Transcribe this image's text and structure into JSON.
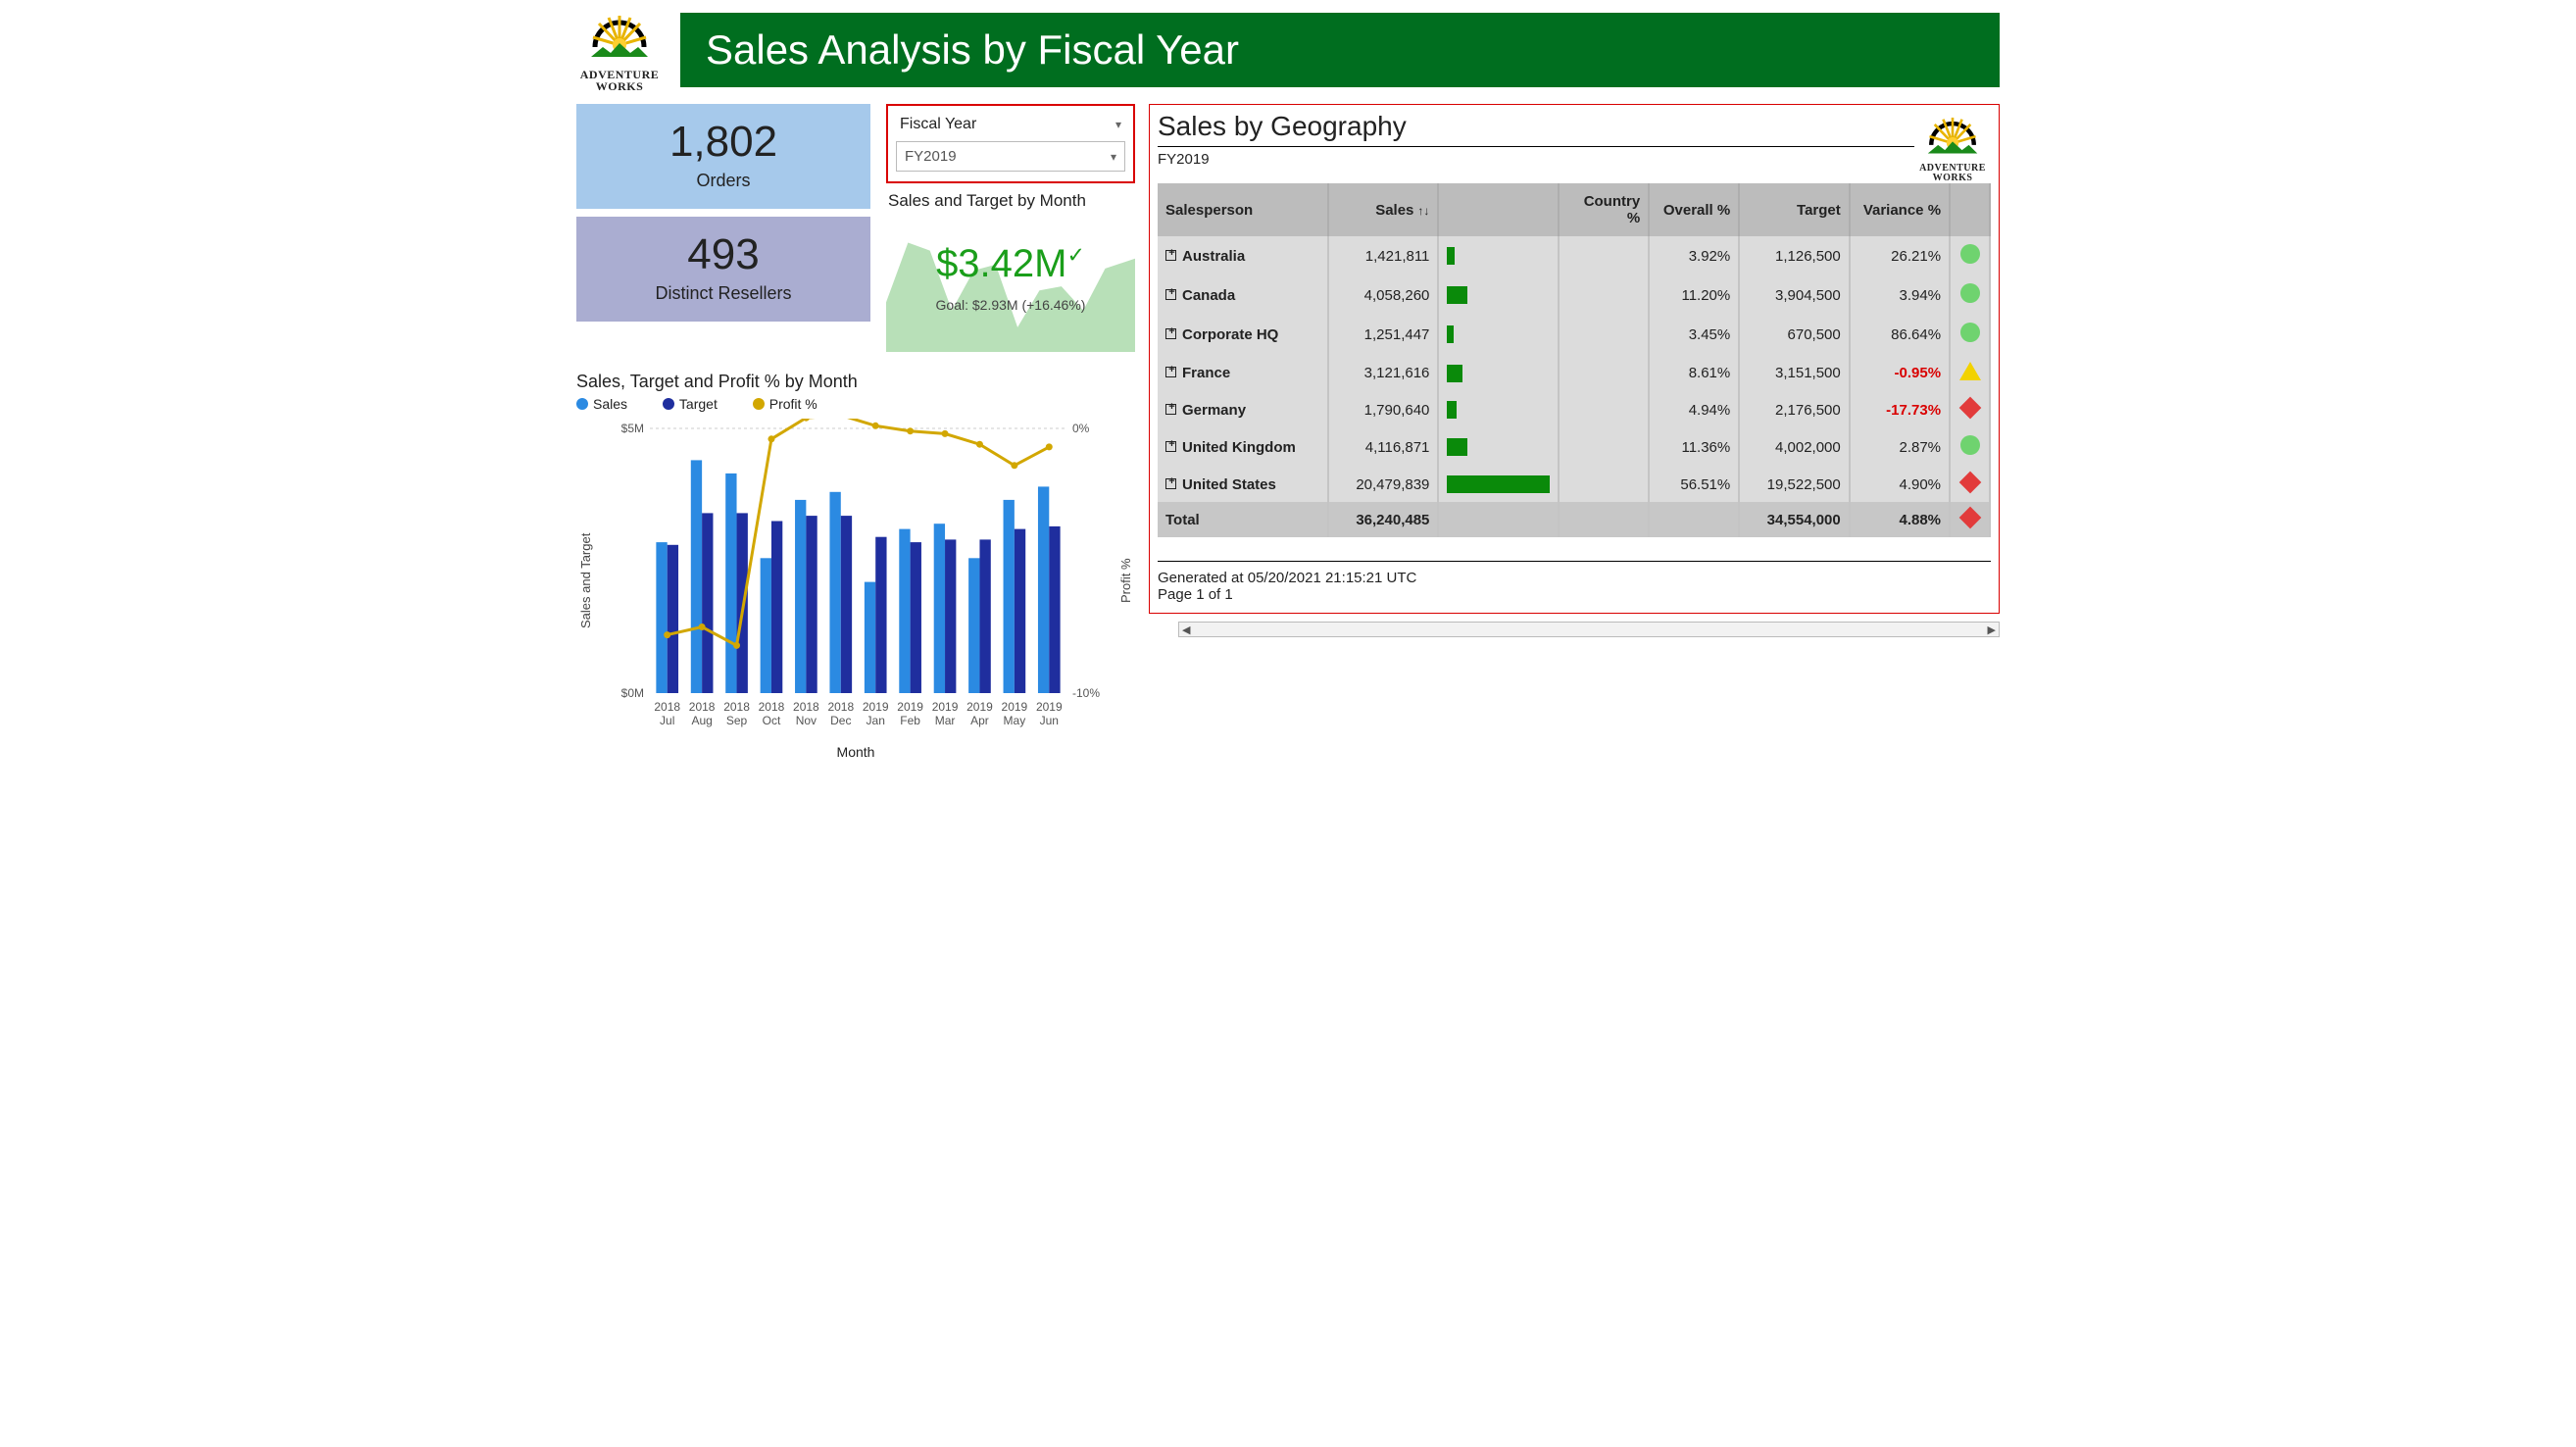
{
  "header": {
    "title": "Sales Analysis by Fiscal Year",
    "logo_top": "ADVENTURE",
    "logo_bot": "WORKS"
  },
  "cards": {
    "orders_value": "1,802",
    "orders_label": "Orders",
    "resellers_value": "493",
    "resellers_label": "Distinct Resellers"
  },
  "slicer": {
    "label": "Fiscal Year",
    "value": "FY2019"
  },
  "mini": {
    "title": "Sales and Target by Month",
    "value": "$3.42M",
    "goal": "Goal: $2.93M (+16.46%)"
  },
  "combo": {
    "title": "Sales, Target and Profit % by Month",
    "legend": {
      "sales": "Sales",
      "target": "Target",
      "profit": "Profit %"
    },
    "y_left_label": "Sales and Target",
    "y_right_label": "Profit %",
    "x_label": "Month"
  },
  "geo": {
    "title": "Sales by Geography",
    "fy": "FY2019",
    "cols": {
      "sp": "Salesperson",
      "sales": "Sales",
      "country": "Country %",
      "overall": "Overall %",
      "target": "Target",
      "var": "Variance %"
    },
    "footer1": "Generated at 05/20/2021 21:15:21 UTC",
    "footer2": "Page 1 of 1",
    "rows": [
      {
        "name": "Australia",
        "sales": "1,421,811",
        "overall": "3.92%",
        "target": "1,126,500",
        "var": "26.21%",
        "ind": "g"
      },
      {
        "name": "Canada",
        "sales": "4,058,260",
        "overall": "11.20%",
        "target": "3,904,500",
        "var": "3.94%",
        "ind": "g"
      },
      {
        "name": "Corporate HQ",
        "sales": "1,251,447",
        "overall": "3.45%",
        "target": "670,500",
        "var": "86.64%",
        "ind": "g"
      },
      {
        "name": "France",
        "sales": "3,121,616",
        "overall": "8.61%",
        "target": "3,151,500",
        "var": "-0.95%",
        "ind": "y"
      },
      {
        "name": "Germany",
        "sales": "1,790,640",
        "overall": "4.94%",
        "target": "2,176,500",
        "var": "-17.73%",
        "ind": "r"
      },
      {
        "name": "United Kingdom",
        "sales": "4,116,871",
        "overall": "11.36%",
        "target": "4,002,000",
        "var": "2.87%",
        "ind": "g"
      },
      {
        "name": "United States",
        "sales": "20,479,839",
        "overall": "56.51%",
        "target": "19,522,500",
        "var": "4.90%",
        "ind": "r"
      }
    ],
    "total": {
      "name": "Total",
      "sales": "36,240,485",
      "target": "34,554,000",
      "var": "4.88%",
      "ind": "r"
    }
  },
  "chart_data": [
    {
      "type": "bar+line",
      "title": "Sales, Target and Profit % by Month",
      "categories": [
        "2018 Jul",
        "2018 Aug",
        "2018 Sep",
        "2018 Oct",
        "2018 Nov",
        "2018 Dec",
        "2019 Jan",
        "2019 Feb",
        "2019 Mar",
        "2019 Apr",
        "2019 May",
        "2019 Jun"
      ],
      "series": [
        {
          "name": "Sales",
          "axis": "left",
          "type": "bar",
          "values": [
            2.85,
            4.4,
            4.15,
            2.55,
            3.65,
            3.8,
            2.1,
            3.1,
            3.2,
            2.55,
            3.65,
            3.9
          ]
        },
        {
          "name": "Target",
          "axis": "left",
          "type": "bar",
          "values": [
            2.8,
            3.4,
            3.4,
            3.25,
            3.35,
            3.35,
            2.95,
            2.85,
            2.9,
            2.9,
            3.1,
            3.15
          ]
        },
        {
          "name": "Profit %",
          "axis": "right",
          "type": "line",
          "values": [
            -7.8,
            -7.5,
            -8.2,
            -0.4,
            0.4,
            0.5,
            0.1,
            -0.1,
            -0.2,
            -0.6,
            -1.4,
            -0.7
          ]
        }
      ],
      "y_left": {
        "label": "Sales and Target",
        "unit": "$M",
        "ticks": [
          0,
          5
        ]
      },
      "y_right": {
        "label": "Profit %",
        "unit": "%",
        "ticks": [
          -10,
          0
        ]
      },
      "xlabel": "Month"
    },
    {
      "type": "area",
      "title": "Sales and Target by Month (sparkline)",
      "kpi_value": "$3.42M",
      "goal": "$2.93M",
      "goal_delta_pct": 16.46,
      "values": [
        2.85,
        4.4,
        4.15,
        2.55,
        3.65,
        3.8,
        2.1,
        3.1,
        3.2,
        2.55,
        3.65,
        3.9
      ]
    },
    {
      "type": "table",
      "title": "Sales by Geography",
      "filter": "FY2019",
      "columns": [
        "Salesperson",
        "Sales",
        "Country %",
        "Overall %",
        "Target",
        "Variance %"
      ],
      "rows": [
        [
          "Australia",
          1421811,
          null,
          3.92,
          1126500,
          26.21
        ],
        [
          "Canada",
          4058260,
          null,
          11.2,
          3904500,
          3.94
        ],
        [
          "Corporate HQ",
          1251447,
          null,
          3.45,
          670500,
          86.64
        ],
        [
          "France",
          3121616,
          null,
          8.61,
          3151500,
          -0.95
        ],
        [
          "Germany",
          1790640,
          null,
          4.94,
          2176500,
          -17.73
        ],
        [
          "United Kingdom",
          4116871,
          null,
          11.36,
          4002000,
          2.87
        ],
        [
          "United States",
          20479839,
          null,
          56.51,
          19522500,
          4.9
        ]
      ],
      "total": [
        "Total",
        36240485,
        null,
        null,
        34554000,
        4.88
      ]
    }
  ]
}
